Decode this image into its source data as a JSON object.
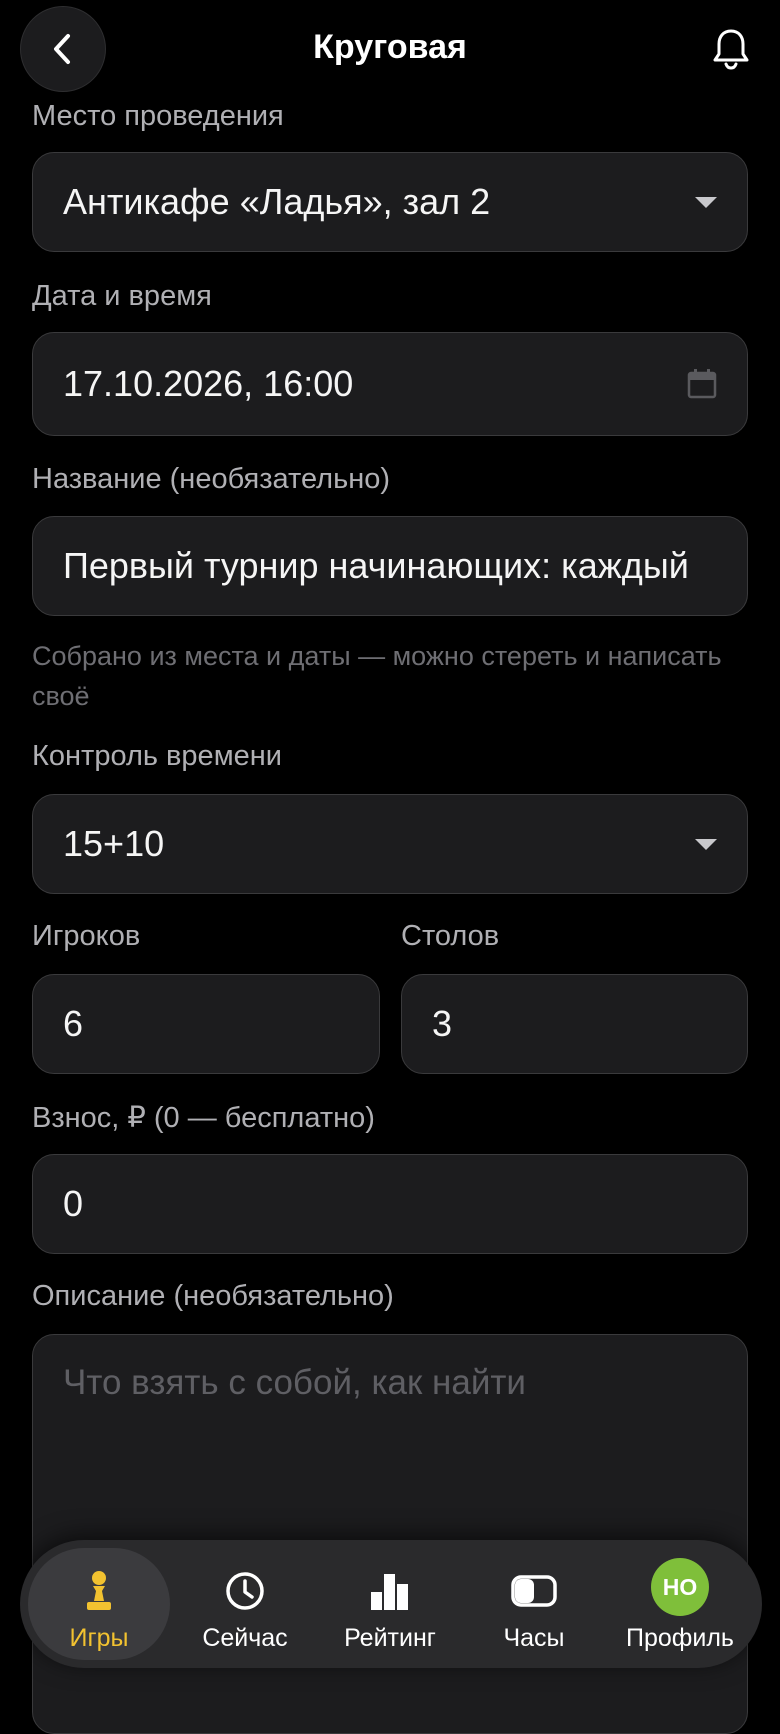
{
  "header": {
    "title": "Круговая"
  },
  "form": {
    "venue": {
      "label": "Место проведения",
      "value": "Антикафе «Ладья», зал 2"
    },
    "datetime": {
      "label": "Дата и время",
      "value": "17.10.2026, 16:00"
    },
    "name": {
      "label": "Название (необязательно)",
      "value": "Первый турнир начинающих: каждый",
      "hint": "Собрано из места и даты — можно стереть и написать своё"
    },
    "time_control": {
      "label": "Контроль времени",
      "value": "15+10"
    },
    "players": {
      "label": "Игроков",
      "value": "6"
    },
    "tables": {
      "label": "Столов",
      "value": "3"
    },
    "fee": {
      "label": "Взнос, ₽ (0 — бесплатно)",
      "value": "0"
    },
    "description": {
      "label": "Описание (необязательно)",
      "placeholder": "Что взять с собой, как найти"
    }
  },
  "tabbar": {
    "items": [
      {
        "label": "Игры",
        "icon": "pawn-icon",
        "active": true
      },
      {
        "label": "Сейчас",
        "icon": "clock-icon",
        "active": false
      },
      {
        "label": "Рейтинг",
        "icon": "bar-chart-icon",
        "active": false
      },
      {
        "label": "Часы",
        "icon": "chess-clock-icon",
        "active": false
      },
      {
        "label": "Профиль",
        "icon": "avatar",
        "active": false
      }
    ],
    "avatar_initials": "НО"
  },
  "colors": {
    "accent": "#f2c230",
    "avatar": "#7fbf3a",
    "background": "#000000",
    "field": "#1c1c1e"
  }
}
